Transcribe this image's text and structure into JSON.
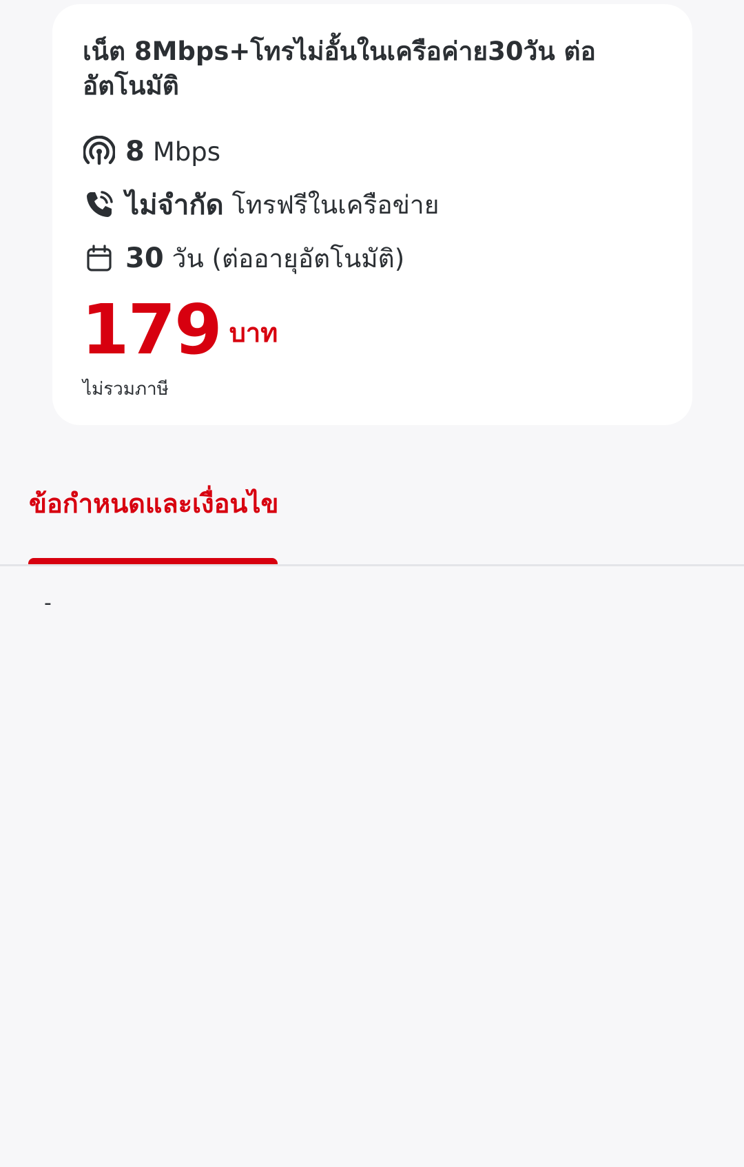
{
  "package": {
    "title": "เน็ต 8Mbps+โทรไม่อั้นในเครือค่าย30วัน ต่ออัตโนมัติ",
    "features": [
      {
        "icon": "signal-icon",
        "strong": "8",
        "text": "Mbps"
      },
      {
        "icon": "phone-call-icon",
        "strong": "ไม่จำกัด",
        "text": "โทรฟรีในเครือข่าย"
      },
      {
        "icon": "calendar-icon",
        "strong": "30",
        "text": "วัน (ต่ออายุอัตโนมัติ)"
      }
    ],
    "price": "179",
    "currency": "บาท",
    "tax_note": "ไม่รวมภาษี"
  },
  "tabs": [
    {
      "label": "ข้อกำหนดและเงื่อนไข",
      "active": true
    }
  ],
  "terms": {
    "content": "-"
  },
  "colors": {
    "accent": "#d7000f",
    "text": "#2b2f33",
    "background": "#f7f7f9",
    "card": "#ffffff"
  }
}
